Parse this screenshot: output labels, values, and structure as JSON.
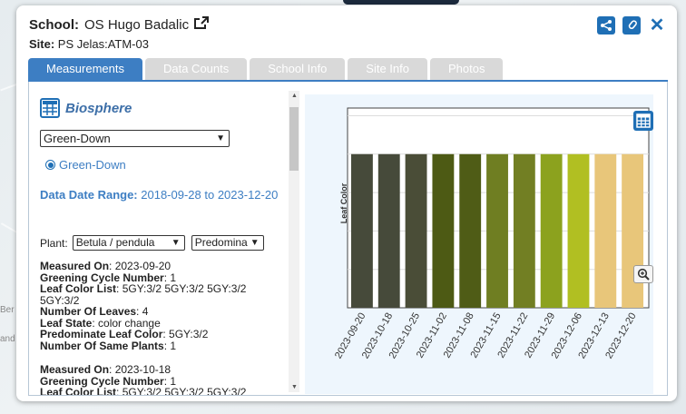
{
  "header": {
    "school_label": "School:",
    "school_name": "OS Hugo Badalic",
    "site_label": "Site:",
    "site_name": "PS Jelas:ATM-03"
  },
  "tabs": [
    {
      "label": "Measurements",
      "active": true
    },
    {
      "label": "Data Counts",
      "active": false
    },
    {
      "label": "School Info",
      "active": false
    },
    {
      "label": "Site Info",
      "active": false
    },
    {
      "label": "Photos",
      "active": false
    }
  ],
  "panel": {
    "title": "Biosphere",
    "protocol_select": "Green-Down",
    "radio_label": "Green-Down",
    "date_range_label": "Data Date Range:",
    "date_range_value": "2018-09-28 to 2023-12-20",
    "plant_label": "Plant:",
    "plant_select": "Betula / pendula",
    "color_select": "Predomina"
  },
  "records": [
    {
      "measured_on_label": "Measured On",
      "measured_on": "2023-09-20",
      "greening_label": "Greening Cycle Number",
      "greening": "1",
      "leaf_color_list_label": "Leaf Color List",
      "leaf_color_list": "5GY:3/2 5GY:3/2 5GY:3/2 5GY:3/2",
      "leaves_label": "Number Of Leaves",
      "leaves": "4",
      "leaf_state_label": "Leaf State",
      "leaf_state": "color change",
      "predominate_label": "Predominate Leaf Color",
      "predominate": "5GY:3/2",
      "same_plants_label": "Number Of Same Plants",
      "same_plants": "1"
    },
    {
      "measured_on_label": "Measured On",
      "measured_on": "2023-10-18",
      "greening_label": "Greening Cycle Number",
      "greening": "1",
      "leaf_color_list_label": "Leaf Color List",
      "leaf_color_list": "5GY:3/2 5GY:3/2 5GY:3/2"
    }
  ],
  "map": {
    "label_left": "Ber",
    "label_left2": "and"
  },
  "chart_data": {
    "type": "bar",
    "ylabel": "Leaf Color",
    "categories": [
      "2023-09-20",
      "2023-10-18",
      "2023-10-25",
      "2023-11-02",
      "2023-11-08",
      "2023-11-15",
      "2023-11-22",
      "2023-11-29",
      "2023-12-06",
      "2023-12-13",
      "2023-12-20"
    ],
    "values": [
      1,
      1,
      1,
      1,
      1,
      1,
      1,
      1,
      1,
      1,
      1
    ],
    "ylim": [
      0,
      1.3
    ],
    "bar_colors": [
      "#464a3a",
      "#464a3a",
      "#4a4d37",
      "#4d5a14",
      "#4f5c16",
      "#6f7e22",
      "#727f23",
      "#8ca21e",
      "#b1bf22",
      "#e8c67a",
      "#e8c67a"
    ],
    "grid": true
  }
}
